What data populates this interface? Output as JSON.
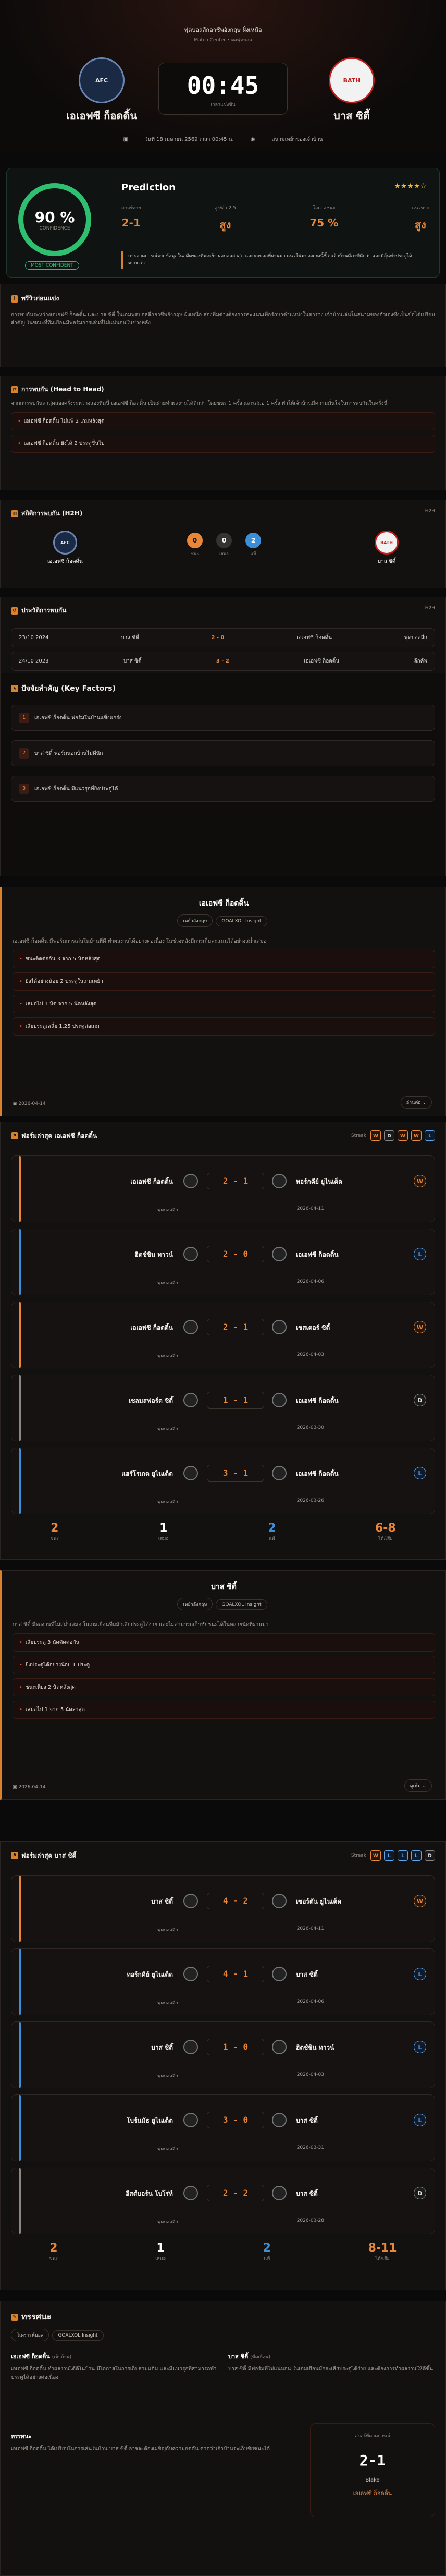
{
  "header": {
    "competition": "ฟุตบอลลีกอาชีพอังกฤษ ฝั่งเหนือ",
    "round": "Match Center • ผลฟุตบอล",
    "home": "เอเอฟซี ก็อดดิ้น",
    "away": "บาส ซิตี้",
    "score": "00:45",
    "score_label": "เวลาแข่งขัน",
    "date": "วันที่ 18 เมษายน 2569 เวลา 00:45 น.",
    "venue": "สนามเหย้าของเจ้าบ้าน"
  },
  "prediction": {
    "title": "Prediction",
    "confidence": "90 %",
    "confidence_label": "CONFIDENCE",
    "badge": "MOST CONFIDENT",
    "stars": "★★★★☆",
    "cols": [
      {
        "label": "สกอร์ทาย",
        "value": "2-1"
      },
      {
        "label": "สูง/ต่ำ 2.5",
        "value": "สูง"
      },
      {
        "label": "โอกาสชนะ",
        "value": "75 %"
      },
      {
        "label": "แนวทาง",
        "value": "สูง"
      }
    ],
    "note": "การคาดการณ์จากข้อมูลในอดีตของทีมเหย้า ผลบอลล่าสุด และผลบอลที่ผ่านมา แนวโน้มของเกมนี้ชี้ว่าเจ้าบ้านมีภาษีดีกว่า และมีลุ้นทำประตูได้มากกว่า"
  },
  "analysis": {
    "title": "พรีวิวก่อนแข่ง",
    "body": "การพบกันระหว่างเอเอฟซี ก็อดดิ้น และบาส ซิตี้ ในเกมฟุตบอลลีกอาชีพอังกฤษ ฝั่งเหนือ สองทีมต่างต้องการคะแนนเพื่อรักษาตำแหน่งในตาราง เจ้าบ้านเล่นในสนามของตัวเองซึ่งเป็นข้อได้เปรียบสำคัญ ในขณะที่ทีมเยือนมีฟอร์มการเล่นที่ไม่แน่นอนในช่วงหลัง"
  },
  "h2h": {
    "title": "การพบกัน (Head to Head)",
    "body": "จากการพบกันล่าสุดสองครั้งระหว่างสองทีมนี้ เอเอฟซี ก็อดดิ้น เป็นฝ่ายทำผลงานได้ดีกว่า โดยชนะ 1 ครั้ง และเสมอ 1 ครั้ง ทำให้เจ้าบ้านมีความมั่นใจในการพบกันในครั้งนี้",
    "items": [
      "เอเอฟซี ก็อดดิ้น ไม่แพ้ 2 เกมหลังสุด",
      "เอเอฟซี ก็อดดิ้น ยิงได้ 2 ประตูขึ้นไป"
    ]
  },
  "stats": {
    "title": "สถิติการพบกัน (H2H)",
    "badge": "H2H",
    "home": "เอเอฟซี ก็อดดิ้น",
    "away": "บาส ซิตี้",
    "wins": "0",
    "draws": "0",
    "losses": "2",
    "wl": "ชนะ",
    "dl": "เสมอ",
    "ll": "แพ้"
  },
  "recent": {
    "title": "ประวัติการพบกัน",
    "badge": "H2H",
    "rows": [
      {
        "date": "23/10 2024",
        "home": "บาส ซิตี้",
        "score": "2 - 0",
        "away": "เอเอฟซี ก็อดดิ้น",
        "comp": "ฟุตบอลลีก"
      },
      {
        "date": "24/10 2023",
        "home": "บาส ซิตี้",
        "score": "3 - 2",
        "away": "เอเอฟซี ก็อดดิ้น",
        "comp": "ลีกคัพ"
      }
    ]
  },
  "factors": {
    "title": "ปัจจัยสำคัญ (Key Factors)",
    "items": [
      "เอเอฟซี ก็อดดิ้น ฟอร์มในบ้านแข็งแกร่ง",
      "บาส ซิตี้ ฟอร์มนอกบ้านไม่ดีนัก",
      "เอเอฟซี ก็อดดิ้น มีแนวรุกที่ยิงประตูได้"
    ]
  },
  "home_form": {
    "name": "เอเอฟซี ก็อดดิ้น",
    "chips": [
      "เหย้าอังกฤษ",
      "GOALXOL Insight"
    ],
    "body": "เอเอฟซี ก็อดดิ้น มีฟอร์มการเล่นในบ้านที่ดี ทำผลงานได้อย่างต่อเนื่อง ในช่วงหลังมีการเก็บคะแนนได้อย่างสม่ำเสมอ",
    "items": [
      "ชนะติดต่อกัน 3 จาก 5 นัดหลังสุด",
      "ยิงได้อย่างน้อย 2 ประตูในเกมเหย้า",
      "เสมอไป 1 นัด จาก 5 นัดหลังสุด",
      "เสียประตูเฉลี่ย 1.25 ประตูต่อเกม"
    ],
    "date": "2026-04-14",
    "more": "อ่านต่อ"
  },
  "home_matches": {
    "title": "ฟอร์มล่าสุด เอเอฟซี ก็อดดิ้น",
    "streak": "Streak",
    "form": [
      "W",
      "D",
      "W",
      "W",
      "L"
    ],
    "rows": [
      {
        "home": "เอเอฟซี ก็อดดิ้น",
        "score": "2 - 1",
        "away": "ทอร์กคีย์ ยูไนเต็ด",
        "comp": "ฟุตบอลลีก",
        "date": "2026-04-11",
        "res": "W"
      },
      {
        "home": "ฮิตช์ชิน ทาวน์",
        "score": "2 - 0",
        "away": "เอเอฟซี ก็อดดิ้น",
        "comp": "ฟุตบอลลีก",
        "date": "2026-04-06",
        "res": "L"
      },
      {
        "home": "เอเอฟซี ก็อดดิ้น",
        "score": "2 - 1",
        "away": "เชสเตอร์ ซิตี้",
        "comp": "ฟุตบอลลีก",
        "date": "2026-04-03",
        "res": "W"
      },
      {
        "home": "เชลมสฟอร์ด ซิตี้",
        "score": "1 - 1",
        "away": "เอเอฟซี ก็อดดิ้น",
        "comp": "ฟุตบอลลีก",
        "date": "2026-03-30",
        "res": "D"
      },
      {
        "home": "แฮร์โรเกต ยูไนเต็ด",
        "score": "3 - 1",
        "away": "เอเอฟซี ก็อดดิ้น",
        "comp": "ฟุตบอลลีก",
        "date": "2026-03-26",
        "res": "L"
      }
    ],
    "sum": [
      {
        "v": "2",
        "l": "ชนะ"
      },
      {
        "v": "1",
        "l": "เสมอ"
      },
      {
        "v": "2",
        "l": "แพ้"
      },
      {
        "v": "6-8",
        "l": "ได้/เสีย"
      }
    ]
  },
  "away_form": {
    "name": "บาส ซิตี้",
    "chips": [
      "เหย้าอังกฤษ",
      "GOALXOL Insight"
    ],
    "body": "บาส ซิตี้ มีผลงานที่ไม่สม่ำเสมอ ในเกมเยือนทีมมักเสียประตูได้ง่าย และไม่สามารถเก็บชัยชนะได้ในหลายนัดที่ผ่านมา",
    "items": [
      "เสียประตู 3 นัดติดต่อกัน",
      "ยิงประตูได้อย่างน้อย 1 ประตู",
      "ชนะเพียง 2 นัดหลังสุด",
      "เสมอไป 1 จาก 5 นัดล่าสุด"
    ],
    "date": "2026-04-14",
    "more": "ดูเพิ่ม"
  },
  "away_matches": {
    "title": "ฟอร์มล่าสุด บาส ซิตี้",
    "streak": "Streak",
    "form": [
      "W",
      "L",
      "L",
      "L",
      "D"
    ],
    "rows": [
      {
        "home": "บาส ซิตี้",
        "score": "4 - 2",
        "away": "เซอร์ตัน ยูไนเต็ด",
        "comp": "ฟุตบอลลีก",
        "date": "2026-04-11",
        "res": "W"
      },
      {
        "home": "ทอร์กคีย์ ยูไนเต็ด",
        "score": "4 - 1",
        "away": "บาส ซิตี้",
        "comp": "ฟุตบอลลีก",
        "date": "2026-04-06",
        "res": "L"
      },
      {
        "home": "บาส ซิตี้",
        "score": "1 - 0",
        "away": "ฮิตช์ชิน ทาวน์",
        "comp": "ฟุตบอลลีก",
        "date": "2026-04-03",
        "res": "L"
      },
      {
        "home": "โบร์นมัธ ยูไนเต็ด",
        "score": "3 - 0",
        "away": "บาส ซิตี้",
        "comp": "ฟุตบอลลีก",
        "date": "2026-03-31",
        "res": "L"
      },
      {
        "home": "อีสต์บอร์น โบโร่ห์",
        "score": "2 - 2",
        "away": "บาส ซิตี้",
        "comp": "ฟุตบอลลีก",
        "date": "2026-03-28",
        "res": "D"
      }
    ],
    "sum": [
      {
        "v": "2",
        "l": "ชนะ"
      },
      {
        "v": "1",
        "l": "เสมอ"
      },
      {
        "v": "2",
        "l": "แพ้"
      },
      {
        "v": "8-11",
        "l": "ได้/เสีย"
      }
    ]
  },
  "summary": {
    "title": "ทรรศนะ",
    "chips": [
      "วิเคราะห์บอล",
      "GOALXOL Insight"
    ],
    "home": "เอเอฟซี ก็อดดิ้น",
    "home_tag": "(เจ้าบ้าน)",
    "away": "บาส ซิตี้",
    "away_tag": "(ทีมเยือน)",
    "home_text": "เอเอฟซี ก็อดดิ้น ทำผลงานได้ดีในบ้าน มีโอกาสในการเก็บสามแต้ม และมีแนวรุกที่สามารถทำประตูได้อย่างต่อเนื่อง",
    "away_text": "บาส ซิตี้ มีฟอร์มที่ไม่แน่นอน ในเกมเยือนมักจะเสียประตูได้ง่าย และต้องการทำผลงานให้ดีขึ้น",
    "bottom_title": "ทรรศนะ",
    "bottom_text": "เอเอฟซี ก็อดดิ้น ได้เปรียบในการเล่นในบ้าน บาส ซิตี้ อาจจะต้องเผชิญกับความกดดัน คาดว่าเจ้าบ้านจะเก็บชัยชนะได้",
    "final_label": "สกอร์ที่คาดการณ์",
    "final_score": "2-1",
    "final_tag": "Blake",
    "final_winner": "เอเอฟซี ก็อดดิ้น"
  }
}
